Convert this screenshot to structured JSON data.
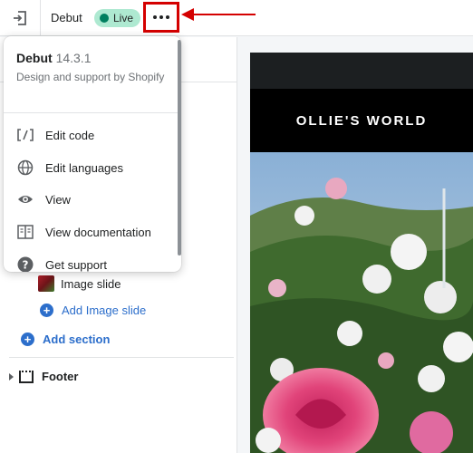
{
  "topbar": {
    "theme_name": "Debut",
    "live_label": "Live",
    "exit_icon": "exit-icon",
    "more_icon": "more-horizontal-icon"
  },
  "popover": {
    "title": "Debut",
    "version": "14.3.1",
    "description": "Design and support by Shopify",
    "items": [
      {
        "label": "Edit code",
        "icon": "code-icon"
      },
      {
        "label": "Edit languages",
        "icon": "globe-icon"
      },
      {
        "label": "View",
        "icon": "eye-icon"
      },
      {
        "label": "View documentation",
        "icon": "book-icon"
      },
      {
        "label": "Get support",
        "icon": "question-icon"
      }
    ]
  },
  "sidebar": {
    "image_slide_label": "Image slide",
    "add_image_slide_label": "Add Image slide",
    "add_section_label": "Add section",
    "footer_label": "Footer"
  },
  "preview": {
    "site_title": "OLLIE'S WORLD"
  },
  "colors": {
    "accent_blue": "#2c6ecb",
    "live_badge_bg": "#aee9d1",
    "live_dot": "#007f5f",
    "highlight_red": "#d40000"
  }
}
